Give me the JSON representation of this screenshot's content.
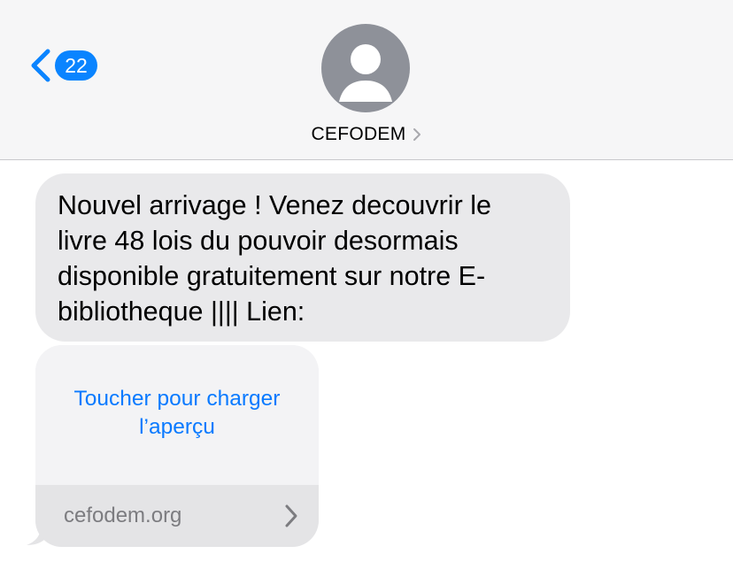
{
  "header": {
    "back_badge": "22",
    "contact_name": "CEFODEM"
  },
  "icons": {
    "back": "chevron-left-icon",
    "contact_disclosure": "chevron-right-icon",
    "avatar": "person-placeholder-icon",
    "link_disclosure": "chevron-right-icon"
  },
  "messages": [
    {
      "text": "Nouvel arrivage ! Venez decouvrir le\nlivre 48 lois du pouvoir desormais\ndisponible gratuitement sur notre E-\nbibliotheque |||| Lien:"
    }
  ],
  "link_preview": {
    "load_label": "Toucher pour charger\nl’aperçu",
    "domain": "cefodem.org"
  },
  "colors": {
    "accent": "#0a84ff",
    "bubble": "#e9e9eb",
    "header_bg": "#f6f6f7"
  }
}
